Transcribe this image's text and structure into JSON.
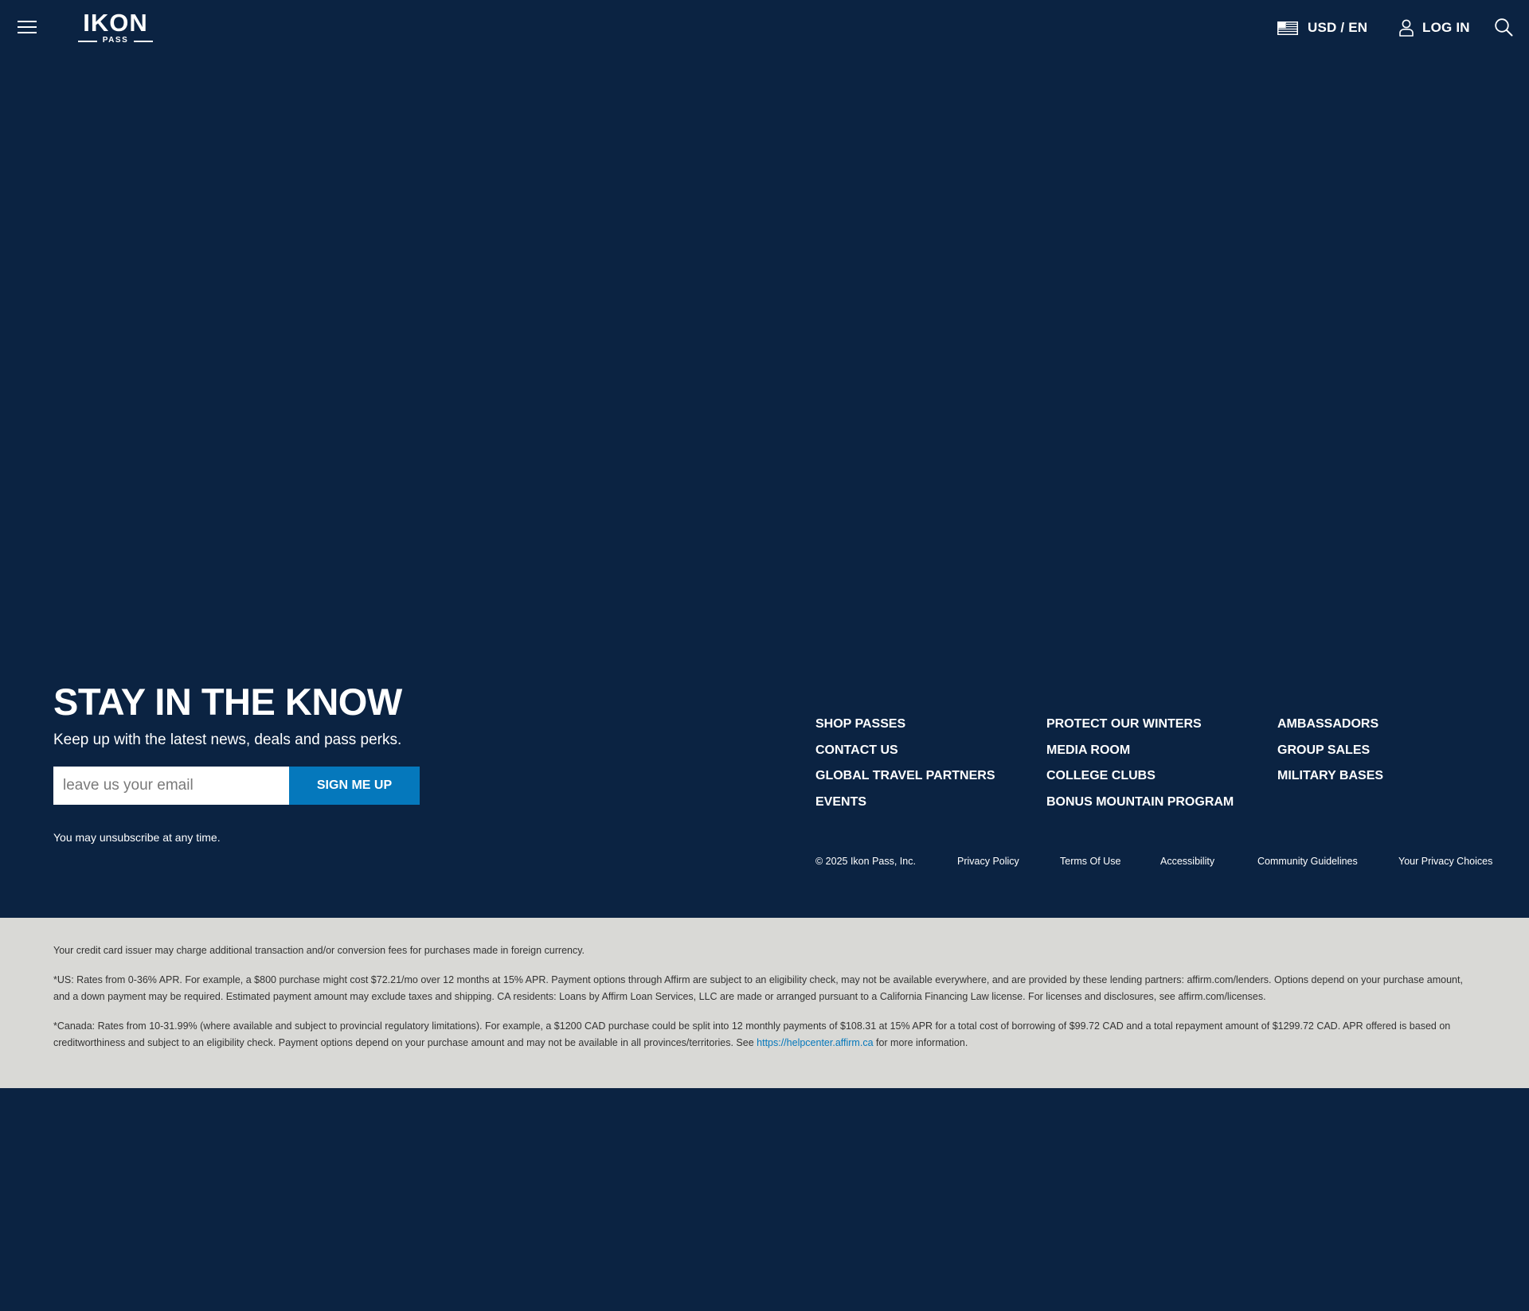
{
  "header": {
    "logo_text": "IKON",
    "logo_sub": "PASS",
    "menu_icon": "hamburger-icon",
    "locale_label": "USD / EN",
    "locale_icon": "us-flag-icon",
    "login_label": "LOG IN",
    "login_icon": "user-icon",
    "search_icon": "search-icon"
  },
  "newsletter": {
    "title": "STAY IN THE KNOW",
    "subtitle": "Keep up with the latest news, deals and pass perks.",
    "email_placeholder": "leave us your email",
    "button_label": "SIGN ME UP",
    "note": "You may unsubscribe at any time."
  },
  "footer": {
    "columns": [
      [
        "SHOP PASSES",
        "CONTACT US",
        "GLOBAL TRAVEL PARTNERS",
        "EVENTS"
      ],
      [
        "PROTECT OUR WINTERS",
        "MEDIA ROOM",
        "COLLEGE CLUBS",
        "BONUS MOUNTAIN PROGRAM"
      ],
      [
        "AMBASSADORS",
        "GROUP SALES",
        "MILITARY BASES"
      ]
    ],
    "copyright": "© 2025 Ikon Pass, Inc.",
    "legal_links": [
      "Privacy Policy",
      "Terms Of Use",
      "Accessibility",
      "Community Guidelines",
      "Your Privacy Choices"
    ]
  },
  "disclaimer": {
    "currency": "Your credit card issuer may charge additional transaction and/or conversion fees for purchases made in foreign currency.",
    "us": "*US: Rates from 0-36% APR. For example, a $800 purchase might cost $72.21/mo over 12 months at 15% APR. Payment options through Affirm are subject to an eligibility check, may not be available everywhere, and are provided by these lending partners: affirm.com/lenders. Options depend on your purchase amount, and a down payment may be required. Estimated payment amount may exclude taxes and shipping. CA residents: Loans by Affirm Loan Services, LLC are made or arranged pursuant to a California Financing Law license. For licenses and disclosures, see affirm.com/licenses.",
    "canada_text": "*Canada: Rates from 10-31.99% (where available and subject to provincial regulatory limitations). For example, a $1200 CAD purchase could be split into 12 monthly payments of $108.31 at 15% APR for a total cost of borrowing of $99.72 CAD and a total repayment amount of $1299.72 CAD. APR offered is based on creditworthiness and subject to an eligibility check. Payment options depend on your purchase amount and may not be available in all provinces/territories. See ",
    "canada_link": "https://helpcenter.affirm.ca",
    "canada_suffix": " for more information."
  },
  "colors": {
    "background": "#0b2342",
    "accent": "#0578bc",
    "disclaimer_bg": "#d9d9d6",
    "disclaimer_text": "#333333"
  }
}
